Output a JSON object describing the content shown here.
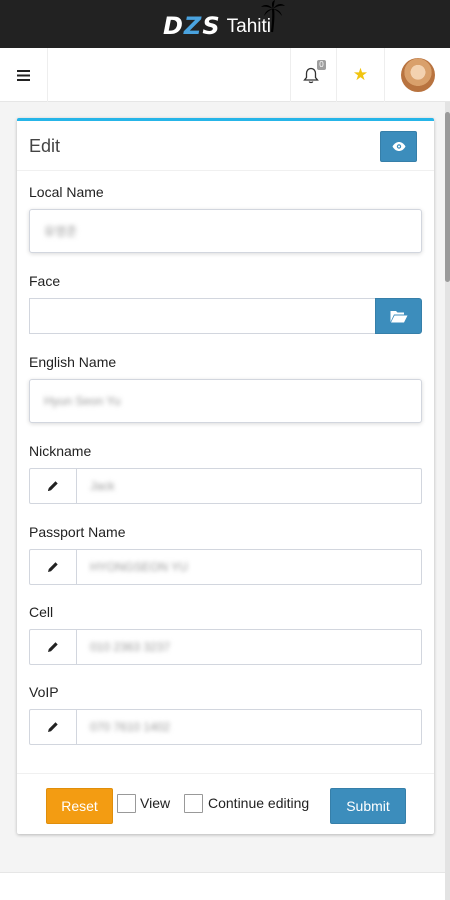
{
  "brand": {
    "name_part1": "D",
    "name_part2": "Z",
    "name_part3": "S",
    "location": "Tahiti"
  },
  "navbar": {
    "menu_icon": "hamburger-icon",
    "notifications": {
      "icon": "bell-icon",
      "count": "0"
    },
    "favorites_icon": "star-icon",
    "avatar_icon": "user-avatar"
  },
  "form": {
    "title": "Edit",
    "view_button_icon": "eye-icon",
    "fields": {
      "local_name": {
        "label": "Local Name",
        "value": "유영준"
      },
      "face": {
        "label": "Face",
        "value": "",
        "browse_icon": "folder-open-icon"
      },
      "english_name": {
        "label": "English Name",
        "value": "Hyun Seon Yu"
      },
      "nickname": {
        "label": "Nickname",
        "value": "Jack",
        "icon": "pencil-icon"
      },
      "passport_name": {
        "label": "Passport Name",
        "value": "HYONGSEON YU",
        "icon": "pencil-icon"
      },
      "cell": {
        "label": "Cell",
        "value": "010 2363 3237",
        "icon": "pencil-icon"
      },
      "voip": {
        "label": "VoIP",
        "value": "070 7610 1402",
        "icon": "pencil-icon"
      }
    },
    "footer": {
      "reset_label": "Reset",
      "view_label": "View",
      "view_checked": false,
      "continue_label": "Continue editing",
      "continue_checked": false,
      "submit_label": "Submit"
    }
  },
  "colors": {
    "topbar": "#222222",
    "accent_blue": "#3c8dbc",
    "card_top_border": "#26b5e8",
    "reset_orange": "#f39c12",
    "star_yellow": "#f1c40f"
  }
}
